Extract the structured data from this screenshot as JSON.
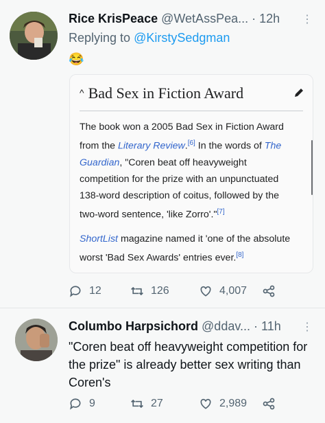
{
  "tweet1": {
    "name": "Rice KrisPeace",
    "handle": "@WetAssPea...",
    "dot": "·",
    "time": "12h",
    "replying_prefix": "Replying to",
    "replying_to": "@KirstySedgman",
    "emoji": "😂",
    "card": {
      "chevron": "^",
      "title": "Bad Sex in Fiction Award",
      "p1_a": "The book won a 2005 Bad Sex in Fiction Award from the ",
      "p1_link1": "Literary Review",
      "p1_ref1": "[6]",
      "p1_b": " In the words of ",
      "p1_link2": "The Guardian",
      "p1_c": ", \"Coren beat off heavyweight competition for the prize with an unpunctuated 138-word description of coitus, followed by the two-word sentence, 'like Zorro'.\"",
      "p1_ref2": "[7]",
      "p2_link": "ShortList",
      "p2_a": " magazine named it 'one of the absolute worst 'Bad Sex Awards' entries ever.",
      "p2_ref": "[8]"
    },
    "replies": "12",
    "retweets": "126",
    "likes": "4,007"
  },
  "tweet2": {
    "name": "Columbo Harpsichord",
    "handle": "@ddav...",
    "dot": "·",
    "time": "11h",
    "text": "\"Coren beat off heavyweight competition for the prize\" is already better sex writing than Coren's",
    "replies": "9",
    "retweets": "27",
    "likes": "2,989"
  },
  "colors": {
    "accent": "#1d9bf0",
    "wiki_link": "#3366cc",
    "muted": "#536471"
  },
  "icons": [
    "reply-icon",
    "retweet-icon",
    "like-icon",
    "share-icon",
    "more-icon",
    "pencil-icon"
  ]
}
